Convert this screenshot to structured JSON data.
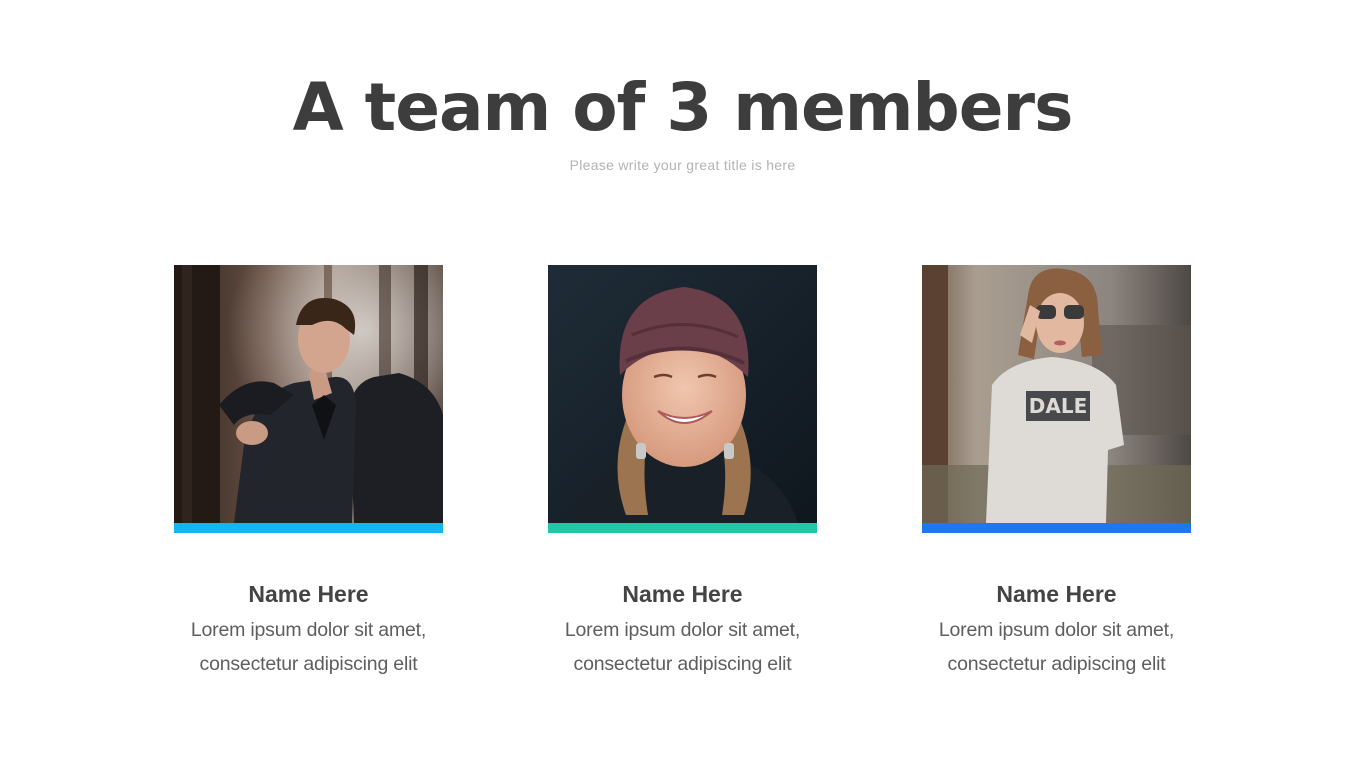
{
  "slide": {
    "title": "A team of 3 members",
    "subtitle": "Please write your great title is here"
  },
  "members": [
    {
      "name": "Name Here",
      "desc_line1": "Lorem ipsum dolor sit amet,",
      "desc_line2": "consectetur adipiscing elit",
      "accent_color": "#13b5f2",
      "photo_icon": "man-portrait-photo"
    },
    {
      "name": "Name Here",
      "desc_line1": "Lorem ipsum dolor sit amet,",
      "desc_line2": "consectetur adipiscing elit",
      "accent_color": "#22c7a5",
      "photo_icon": "girl-beanie-portrait-photo"
    },
    {
      "name": "Name Here",
      "desc_line1": "Lorem ipsum dolor sit amet,",
      "desc_line2": "consectetur adipiscing elit",
      "accent_color": "#1f78ef",
      "photo_icon": "woman-sunglasses-portrait-photo"
    }
  ]
}
